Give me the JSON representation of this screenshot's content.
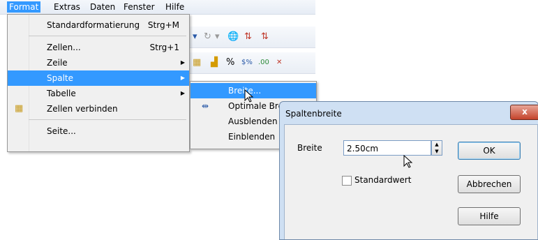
{
  "menubar": {
    "items": [
      {
        "label": "Format",
        "active": true
      },
      {
        "label": "Extras"
      },
      {
        "label": "Daten"
      },
      {
        "label": "Fenster"
      },
      {
        "label": "Hilfe"
      }
    ]
  },
  "format_menu": {
    "items": [
      {
        "label": "Standardformatierung",
        "shortcut": "Strg+M"
      },
      {
        "label": "Zellen...",
        "shortcut": "Strg+1"
      },
      {
        "label": "Zeile",
        "submenu": true
      },
      {
        "label": "Spalte",
        "submenu": true,
        "selected": true
      },
      {
        "label": "Tabelle",
        "submenu": true
      },
      {
        "label": "Zellen verbinden"
      },
      {
        "label": "Seite..."
      }
    ]
  },
  "column_submenu": {
    "items": [
      {
        "label": "Breite...",
        "selected": true
      },
      {
        "label": "Optimale Breite..."
      },
      {
        "label": "Ausblenden"
      },
      {
        "label": "Einblenden"
      }
    ]
  },
  "dialog": {
    "title": "Spaltenbreite",
    "close_label": "x",
    "width_label": "Breite",
    "width_value": "2.50cm",
    "default_label": "Standardwert",
    "ok_label": "OK",
    "cancel_label": "Abbrechen",
    "help_label": "Hilfe"
  },
  "colors": {
    "highlight": "#3399ff",
    "dialog_frame": "#cfe0f3"
  }
}
